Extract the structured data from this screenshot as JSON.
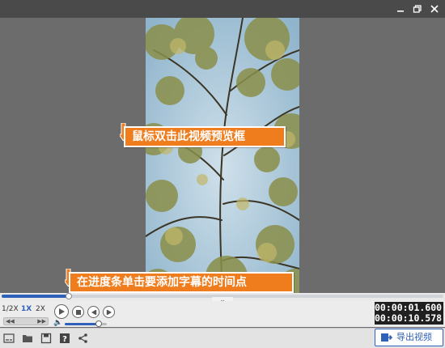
{
  "titlebar": {
    "minimize_icon": "minimize-icon",
    "maximize_icon": "restore-icon",
    "close_icon": "close-icon"
  },
  "callouts": {
    "preview_hint": "鼠标双击此视频预览框",
    "timeline_hint": "在进度条单击要添加字幕的时间点"
  },
  "timeline": {
    "progress": 0.152
  },
  "speed": {
    "options": [
      "1/2X",
      "1X",
      "2X"
    ],
    "selected": "1X",
    "left_arrow": "◀◀",
    "right_arrow": "▶▶"
  },
  "volume": {
    "level": 0.8
  },
  "time": {
    "current": "00:00:01.600",
    "total": "00:00:10.578"
  },
  "toolbar": {
    "icons": [
      "subtitle-icon",
      "open-folder-icon",
      "save-icon",
      "help-icon",
      "share-icon"
    ],
    "export_label": "导出视频"
  },
  "colors": {
    "accent": "#2f61b8",
    "callout": "#ef7d1e",
    "background": "#6b6b6b"
  }
}
